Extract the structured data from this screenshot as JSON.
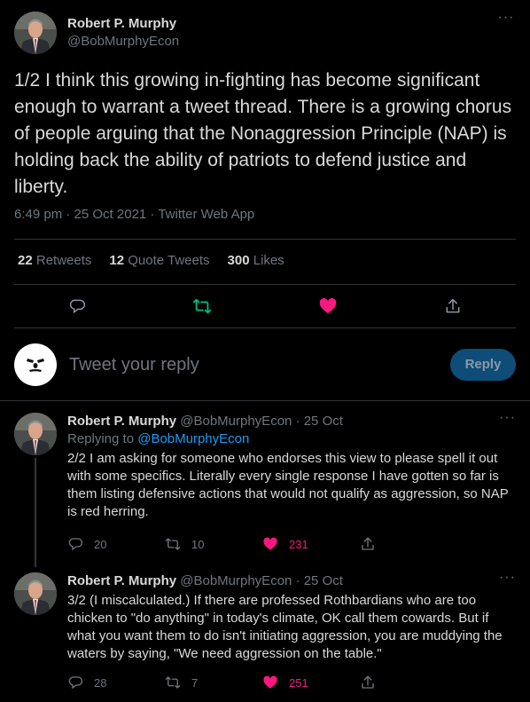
{
  "main_tweet": {
    "author_name": "Robert P. Murphy",
    "author_handle": "@BobMurphyEcon",
    "text": "1/2 I think this growing in-fighting has become significant enough to warrant a tweet thread. There is a growing chorus of people arguing that the Nonaggression Principle (NAP) is holding back the ability of patriots to defend justice and liberty.",
    "timestamp": "6:49 pm · 25 Oct 2021",
    "meta_separator": " · ",
    "source": "Twitter Web App",
    "stats": {
      "retweets_count": "22",
      "retweets_label": "Retweets",
      "quotes_count": "12",
      "quotes_label": "Quote Tweets",
      "likes_count": "300",
      "likes_label": "Likes"
    }
  },
  "reply_composer": {
    "placeholder": "Tweet your reply",
    "button_label": "Reply"
  },
  "replies": [
    {
      "author_name": "Robert P. Murphy",
      "author_handle": "@BobMurphyEcon",
      "dot": " · ",
      "date": "25 Oct",
      "replying_to_label": "Replying to ",
      "replying_to_handle": "@BobMurphyEcon",
      "text": "2/2 I am asking for someone who endorses this view to please spell it out with some specifics. Literally every single response I have gotten so far is them listing defensive actions that would not qualify as aggression, so NAP is red herring.",
      "reply_count": "20",
      "retweet_count": "10",
      "like_count": "231"
    },
    {
      "author_name": "Robert P. Murphy",
      "author_handle": "@BobMurphyEcon",
      "dot": " · ",
      "date": "25 Oct",
      "text": "3/2 (I miscalculated.) If there are professed Rothbardians who are too chicken to \"do anything\" in today's climate, OK call them cowards. But if what you want them to do isn't initiating aggression, you are muddying the waters by saying, \"We need aggression on the table.\"",
      "reply_count": "28",
      "retweet_count": "7",
      "like_count": "251"
    }
  ],
  "colors": {
    "background": "#000000",
    "text": "#d9d9d9",
    "secondary": "#6e767d",
    "accent": "#1d9bf0",
    "like": "#f91880",
    "retweet_active": "#00ba7c",
    "reply_button": "#0e4d78"
  },
  "icons": {
    "more": "more-icon",
    "reply": "reply-icon",
    "retweet": "retweet-icon",
    "like": "heart-icon",
    "share": "share-icon"
  }
}
